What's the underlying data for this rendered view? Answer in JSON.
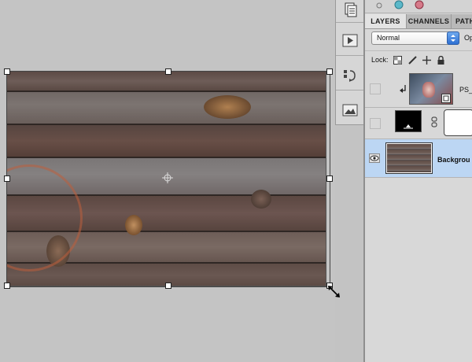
{
  "layers_panel": {
    "tabs": [
      {
        "label": "LAYERS",
        "active": true
      },
      {
        "label": "CHANNELS",
        "active": false
      },
      {
        "label": "PATHS",
        "active": false
      }
    ],
    "blend_mode": "Normal",
    "opacity_label": "Op",
    "lock_label": "Lock:",
    "layers": [
      {
        "name": "PS_N",
        "type": "smart-object",
        "visible": false
      },
      {
        "name": "",
        "type": "adjustment-with-mask",
        "visible": false
      },
      {
        "name": "Backgrou",
        "type": "background",
        "visible": true,
        "selected": true
      }
    ]
  },
  "tool_strip": {
    "icons": [
      "history-icon",
      "actions-icon",
      "clone-source-icon",
      "image-thumbnail-icon"
    ]
  },
  "colors": {
    "canvas_bg": "#c4c4c4",
    "panel_bg": "#d8d8d8",
    "selected_row": "#bcd6f3",
    "wood": "#6a5a52"
  }
}
